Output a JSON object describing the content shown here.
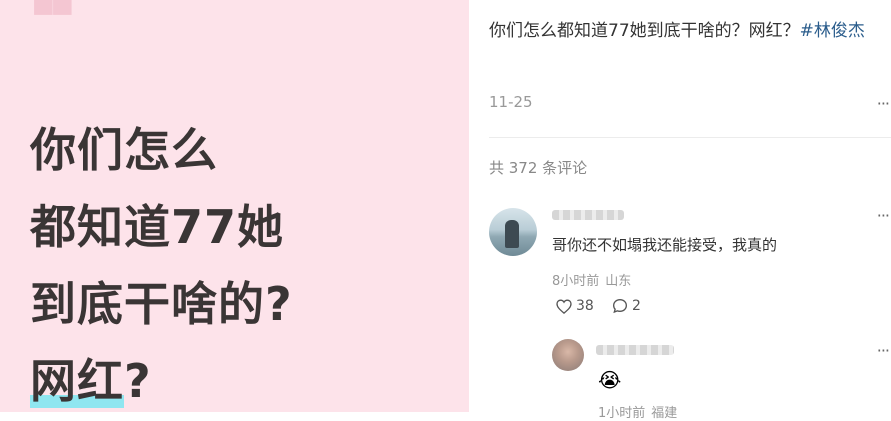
{
  "image": {
    "headline_lines": [
      "你们怎么",
      "都知道77她",
      "到底干啥的?"
    ],
    "highlight_word": "网红",
    "highlight_suffix": "?",
    "quote_glyph": "❝"
  },
  "post": {
    "caption": "你们怎么都知道77她到底干啥的？网红？",
    "hashtag": "#林俊杰",
    "date": "11-25",
    "more": "···"
  },
  "comments": {
    "total_label": "共 372 条评论",
    "items": [
      {
        "text": "哥你还不如塌我还能接受，我真的",
        "time": "8小时前",
        "location": "山东",
        "likes": "38",
        "replies": "2",
        "more": "···"
      }
    ],
    "reply": {
      "sticker": "😭",
      "time": "1小时前",
      "location": "福建",
      "more": "···"
    }
  },
  "colors": {
    "panel_bg": "#fde3ea",
    "headline": "#3a3535",
    "highlight": "#8fe6f0",
    "hashtag": "#2b5d8c"
  }
}
